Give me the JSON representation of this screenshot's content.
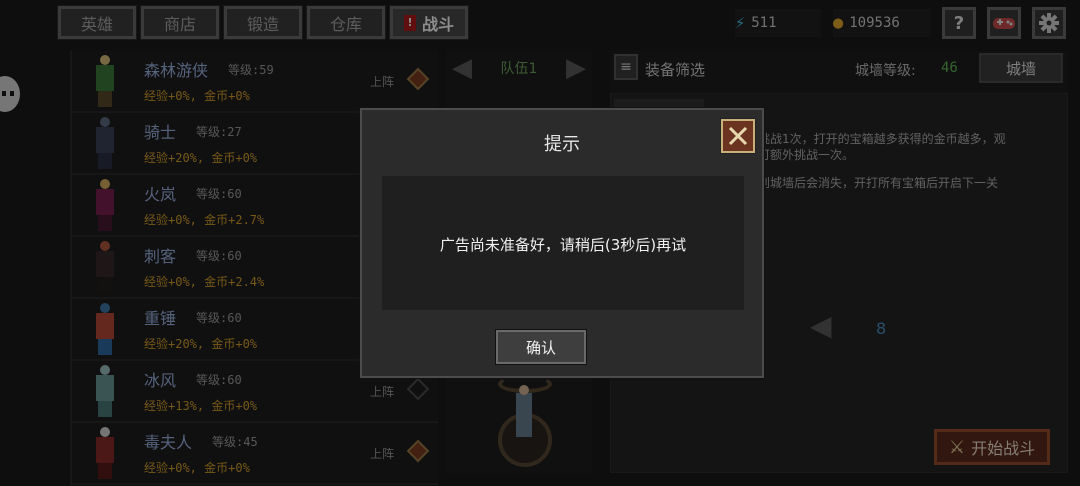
{
  "top_tabs": [
    {
      "label": "英雄",
      "active": false
    },
    {
      "label": "商店",
      "active": false
    },
    {
      "label": "锻造",
      "active": false
    },
    {
      "label": "仓库",
      "active": false
    },
    {
      "label": "战斗",
      "active": true
    }
  ],
  "battle_tab_alert": "!",
  "resources": {
    "energy": "511",
    "gold": "109536"
  },
  "icon_buttons": {
    "help": "?",
    "gamepad": "gamepad",
    "settings": "gear"
  },
  "heroes": [
    {
      "name": "森林游侠",
      "level_label": "等级:59",
      "stats": "经验+0%, 金币+0%",
      "deploy": "上阵",
      "colors": {
        "head": "#d9c07a",
        "body": "#3f7a3a",
        "legs": "#5c4a2a"
      }
    },
    {
      "name": "骑士",
      "level_label": "等级:27",
      "stats": "经验+20%, 金币+0%",
      "deploy": "",
      "colors": {
        "head": "#5e6c86",
        "body": "#3a4258",
        "legs": "#2c3244"
      }
    },
    {
      "name": "火岚",
      "level_label": "等级:60",
      "stats": "经验+0%, 金币+2.7%",
      "deploy": "",
      "colors": {
        "head": "#d4b060",
        "body": "#7a2050",
        "legs": "#4a1830"
      }
    },
    {
      "name": "刺客",
      "level_label": "等级:60",
      "stats": "经验+0%, 金币+2.4%",
      "deploy": "",
      "colors": {
        "head": "#b05a40",
        "body": "#3a2a2a",
        "legs": "#22201e"
      }
    },
    {
      "name": "重锤",
      "level_label": "等级:60",
      "stats": "经验+20%, 金币+0%",
      "deploy": "",
      "colors": {
        "head": "#3b78a8",
        "body": "#b84a3a",
        "legs": "#2e6aa0"
      }
    },
    {
      "name": "冰风",
      "level_label": "等级:60",
      "stats": "经验+13%, 金币+0%",
      "deploy": "上阵",
      "colors": {
        "head": "#9fc4c4",
        "body": "#6a9a9a",
        "legs": "#4c7a7a"
      }
    },
    {
      "name": "毒夫人",
      "level_label": "等级:45",
      "stats": "经验+0%, 金币+0%",
      "deploy": "上阵",
      "colors": {
        "head": "#d6d6d6",
        "body": "#8a2a2a",
        "legs": "#5a1c1c"
      }
    }
  ],
  "team": {
    "title": "队伍1"
  },
  "panel": {
    "filter_label": "装备筛选",
    "wall_level_label": "城墙等级:",
    "wall_level": "46",
    "wall_button": "城墙",
    "desc_line1": "挑战1次，打开的宝箱越多获得的金币越多，观",
    "desc_line1b": "可额外挑战一次。",
    "desc_line2": "到城墙后会消失，开打所有宝箱后开启下一关",
    "page_number": "8",
    "start_battle": "开始战斗"
  },
  "dialog": {
    "title": "提示",
    "message": "广告尚未准备好，请稍后(3秒后)再试",
    "confirm": "确认"
  }
}
